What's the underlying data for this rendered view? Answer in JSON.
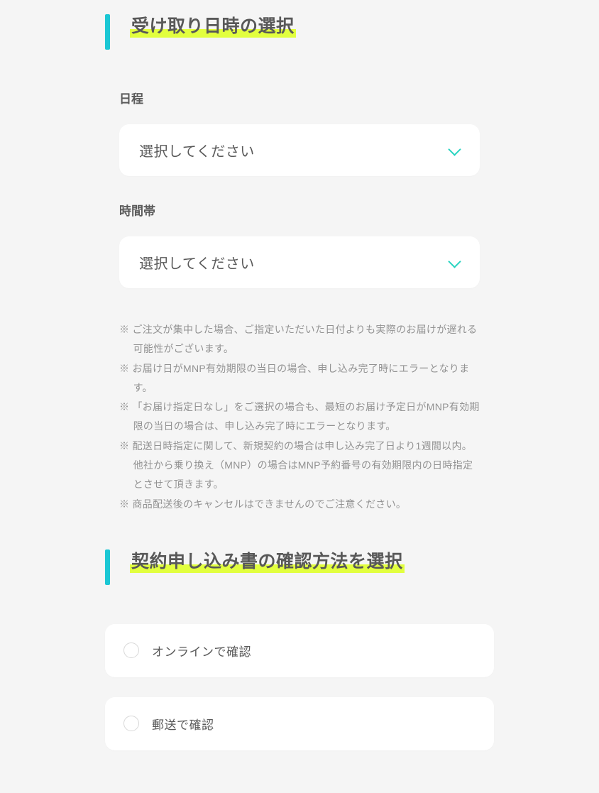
{
  "section1": {
    "title": "受け取り日時の選択",
    "date": {
      "label": "日程",
      "placeholder": "選択してください"
    },
    "time": {
      "label": "時間帯",
      "placeholder": "選択してください"
    },
    "notes": [
      "※ ご注文が集中した場合、ご指定いただいた日付よりも実際のお届けが遅れる可能性がございます。",
      "※ お届け日がMNP有効期限の当日の場合、申し込み完了時にエラーとなります。",
      "※ 「お届け指定日なし」をご選択の場合も、最短のお届け予定日がMNP有効期限の当日の場合は、申し込み完了時にエラーとなります。",
      "※ 配送日時指定に関して、新規契約の場合は申し込み完了日より1週間以内。他社から乗り換え（MNP）の場合はMNP予約番号の有効期限内の日時指定とさせて頂きます。",
      "※ 商品配送後のキャンセルはできませんのでご注意ください。"
    ]
  },
  "section2": {
    "title": "契約申し込み書の確認方法を選択",
    "options": [
      {
        "label": "オンラインで確認"
      },
      {
        "label": "郵送で確認"
      }
    ]
  }
}
